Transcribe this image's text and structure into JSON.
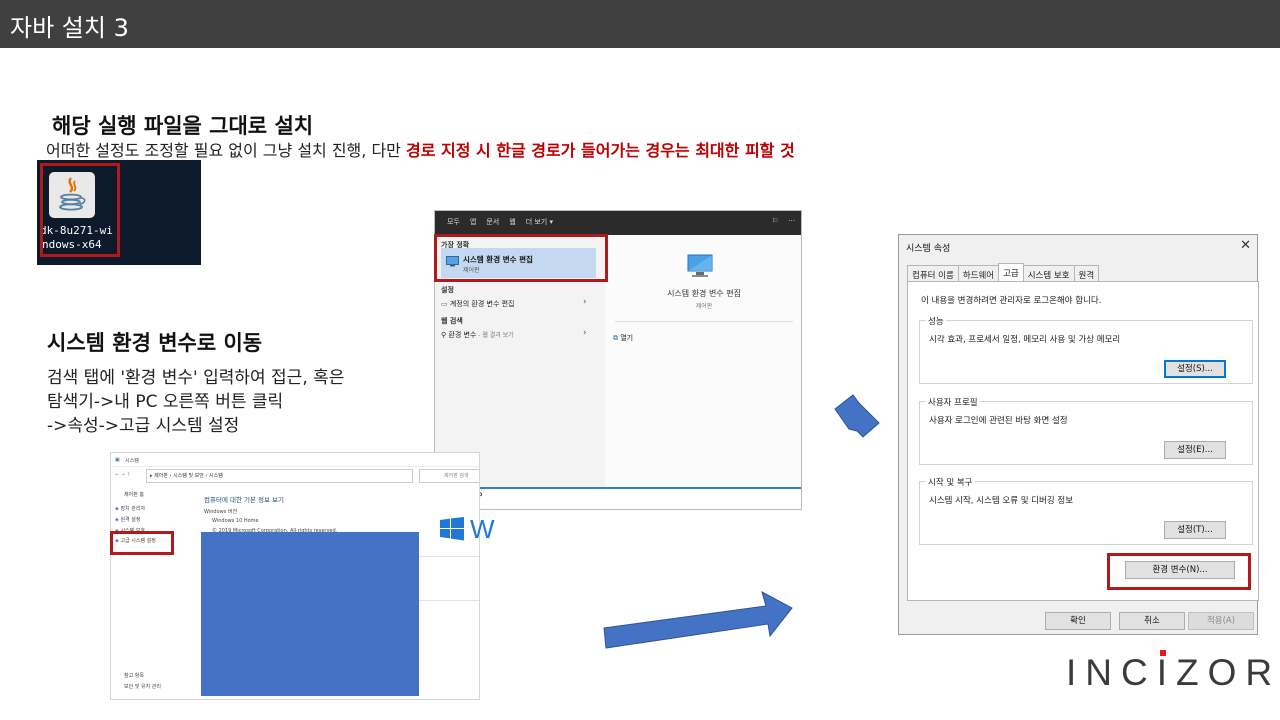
{
  "slide": {
    "title": "자바 설치 3",
    "heading1": "해당 실행 파일을 그대로 설치",
    "line1_plain": "어떠한 설정도 조정할 필요 없이 그냥 설치 진행, 다만 ",
    "line1_red": "경로 지정 시 한글 경로가 들어가는 경우는 최대한 피할 것",
    "heading2": "시스템 환경 변수로 이동",
    "body2": [
      "검색 탭에 '환경 변수' 입력하여 접근, 혹은",
      "탐색기->내 PC 오른쪽 버튼 클릭",
      "->속성->고급 시스템 설정"
    ],
    "logo": [
      "INC",
      "I",
      "ZOR"
    ]
  },
  "desktop_file": {
    "label_line1": "dk-8u271-wi",
    "label_line2": "ndows-x64",
    "icon": "java-icon"
  },
  "start_menu": {
    "tabs": [
      "모두",
      "앱",
      "문서",
      "웹",
      "더 보기 ▾"
    ],
    "best_match_caption": "가장 정확",
    "best_match_title": "시스템 환경 변수 편집",
    "best_match_sub": "제어판",
    "settings_caption": "설정",
    "settings_item": "계정의 환경 변수 편집",
    "web_caption": "웹 검색",
    "web_item": "환경 변수",
    "web_item_sub": " - 웹 결과 보기",
    "right_title": "시스템 환경 변수 편집",
    "right_sub": "제어판",
    "open_label": "열기",
    "search_text": "P"
  },
  "system_window": {
    "title": "시스템",
    "address": "▸ 제어판 › 시스템 및 보안 › 시스템",
    "search_placeholder": "제어판 검색",
    "sidebar_home": "제어판 홈",
    "sidebar_items": [
      "장치 관리자",
      "원격 설정",
      "시스템 보호",
      "고급 시스템 설정"
    ],
    "footer_caption": "참고 항목",
    "footer_item": "보안 및 유지 관리",
    "heading": "컴퓨터에 대한 기본 정보 보기",
    "edition_caption": "Windows 버전",
    "edition": "Windows 10 Home",
    "copyright": "© 2019 Microsoft Corporation. All rights reserved.",
    "brand": "W"
  },
  "sys_props": {
    "title": "시스템 속성",
    "close": "✕",
    "tabs": [
      "컴퓨터 이름",
      "하드웨어",
      "고급",
      "시스템 보호",
      "원격"
    ],
    "active_tab": "고급",
    "note": "이 내용을 변경하려면 관리자로 로그온해야 합니다.",
    "groups": [
      {
        "legend": "성능",
        "desc": "시각 효과, 프로세서 일정, 메모리 사용 및 가상 메모리",
        "button": "설정(S)..."
      },
      {
        "legend": "사용자 프로필",
        "desc": "사용자 로그인에 관련된 바탕 화면 설정",
        "button": "설정(E)..."
      },
      {
        "legend": "시작 및 복구",
        "desc": "시스템 시작, 시스템 오류 및 디버깅 정보",
        "button": "설정(T)..."
      }
    ],
    "env_button": "환경 변수(N)...",
    "ok": "확인",
    "cancel": "취소",
    "apply": "적용(A)"
  },
  "colors": {
    "title_bar": "#404040",
    "highlight_red": "#c00000",
    "box_red": "#b01a1a",
    "arrow_blue": "#4472c4"
  }
}
